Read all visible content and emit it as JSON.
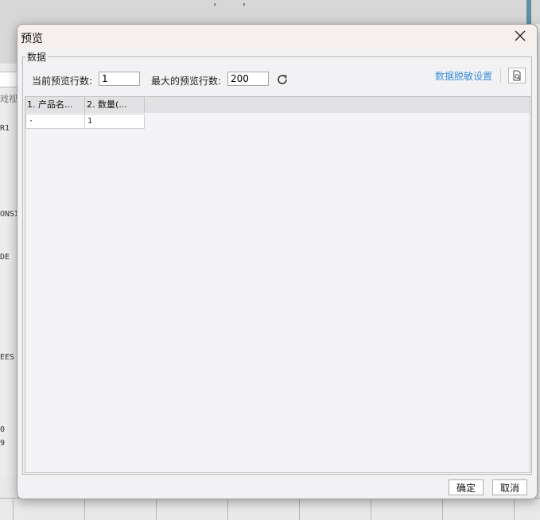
{
  "dialog": {
    "title": "预览",
    "group_label": "数据",
    "current_preview_rows": {
      "label": "当前预览行数:",
      "value": "1"
    },
    "max_preview_rows": {
      "label": "最大的预览行数:",
      "value": "200"
    },
    "mask_settings_link": "数据脱敏设置",
    "columns": [
      {
        "label": "1. 产品名..."
      },
      {
        "label": "2. 数量(..."
      }
    ],
    "rows": [
      [
        "·",
        "1"
      ]
    ],
    "buttons": {
      "ok": "确定",
      "cancel": "取消"
    }
  },
  "background": {
    "partial_labels": [
      "戏视",
      "R1",
      "ONSI",
      "DE",
      "EES",
      "0",
      "9"
    ]
  },
  "colors": {
    "link": "#3a8fd8",
    "titlebar": "#f6efed",
    "dialog_bg": "#f2f2f4",
    "header_bg": "#e2e2e4"
  },
  "icons": [
    "close-icon",
    "refresh-icon",
    "preview-document-icon"
  ]
}
